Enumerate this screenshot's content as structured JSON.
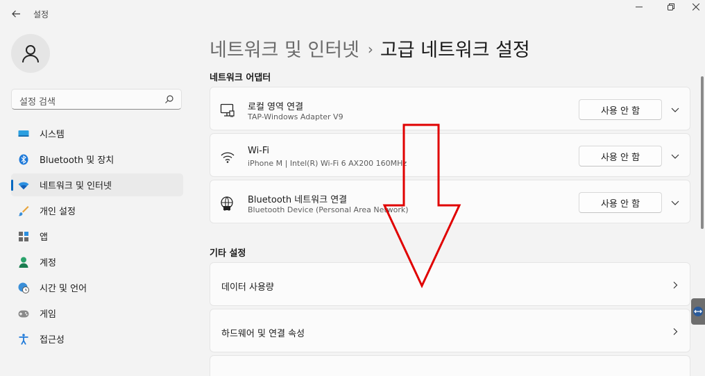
{
  "window": {
    "title": "설정"
  },
  "sidebar": {
    "search_placeholder": "설정 검색",
    "items": [
      {
        "label": "시스템",
        "icon": "monitor-icon"
      },
      {
        "label": "Bluetooth 및 장치",
        "icon": "bluetooth-icon"
      },
      {
        "label": "네트워크 및 인터넷",
        "icon": "wifi-icon",
        "active": true
      },
      {
        "label": "개인 설정",
        "icon": "brush-icon"
      },
      {
        "label": "앱",
        "icon": "apps-icon"
      },
      {
        "label": "계정",
        "icon": "account-icon"
      },
      {
        "label": "시간 및 언어",
        "icon": "globe-clock-icon"
      },
      {
        "label": "게임",
        "icon": "gamepad-icon"
      },
      {
        "label": "접근성",
        "icon": "accessibility-icon"
      }
    ]
  },
  "breadcrumb": {
    "parent": "네트워크 및 인터넷",
    "separator": "›",
    "current": "고급 네트워크 설정"
  },
  "adapters": {
    "section_title": "네트워크 어댑터",
    "items": [
      {
        "title": "로컬 영역 연결",
        "subtitle": "TAP-Windows Adapter V9",
        "button": "사용 안 함",
        "icon": "ethernet-icon"
      },
      {
        "title": "Wi-Fi",
        "subtitle": "iPhone M | Intel(R) Wi-Fi 6 AX200 160MHz",
        "button": "사용 안 함",
        "icon": "wifi-icon"
      },
      {
        "title": "Bluetooth 네트워크 연결",
        "subtitle": "Bluetooth Device (Personal Area Network)",
        "button": "사용 안 함",
        "icon": "bluetooth-network-icon"
      }
    ]
  },
  "other": {
    "section_title": "기타 설정",
    "items": [
      {
        "title": "데이터 사용량"
      },
      {
        "title": "하드웨어 및 연결 속성"
      }
    ]
  },
  "colors": {
    "accent": "#0067c0",
    "annotation_arrow": "#e00000"
  }
}
